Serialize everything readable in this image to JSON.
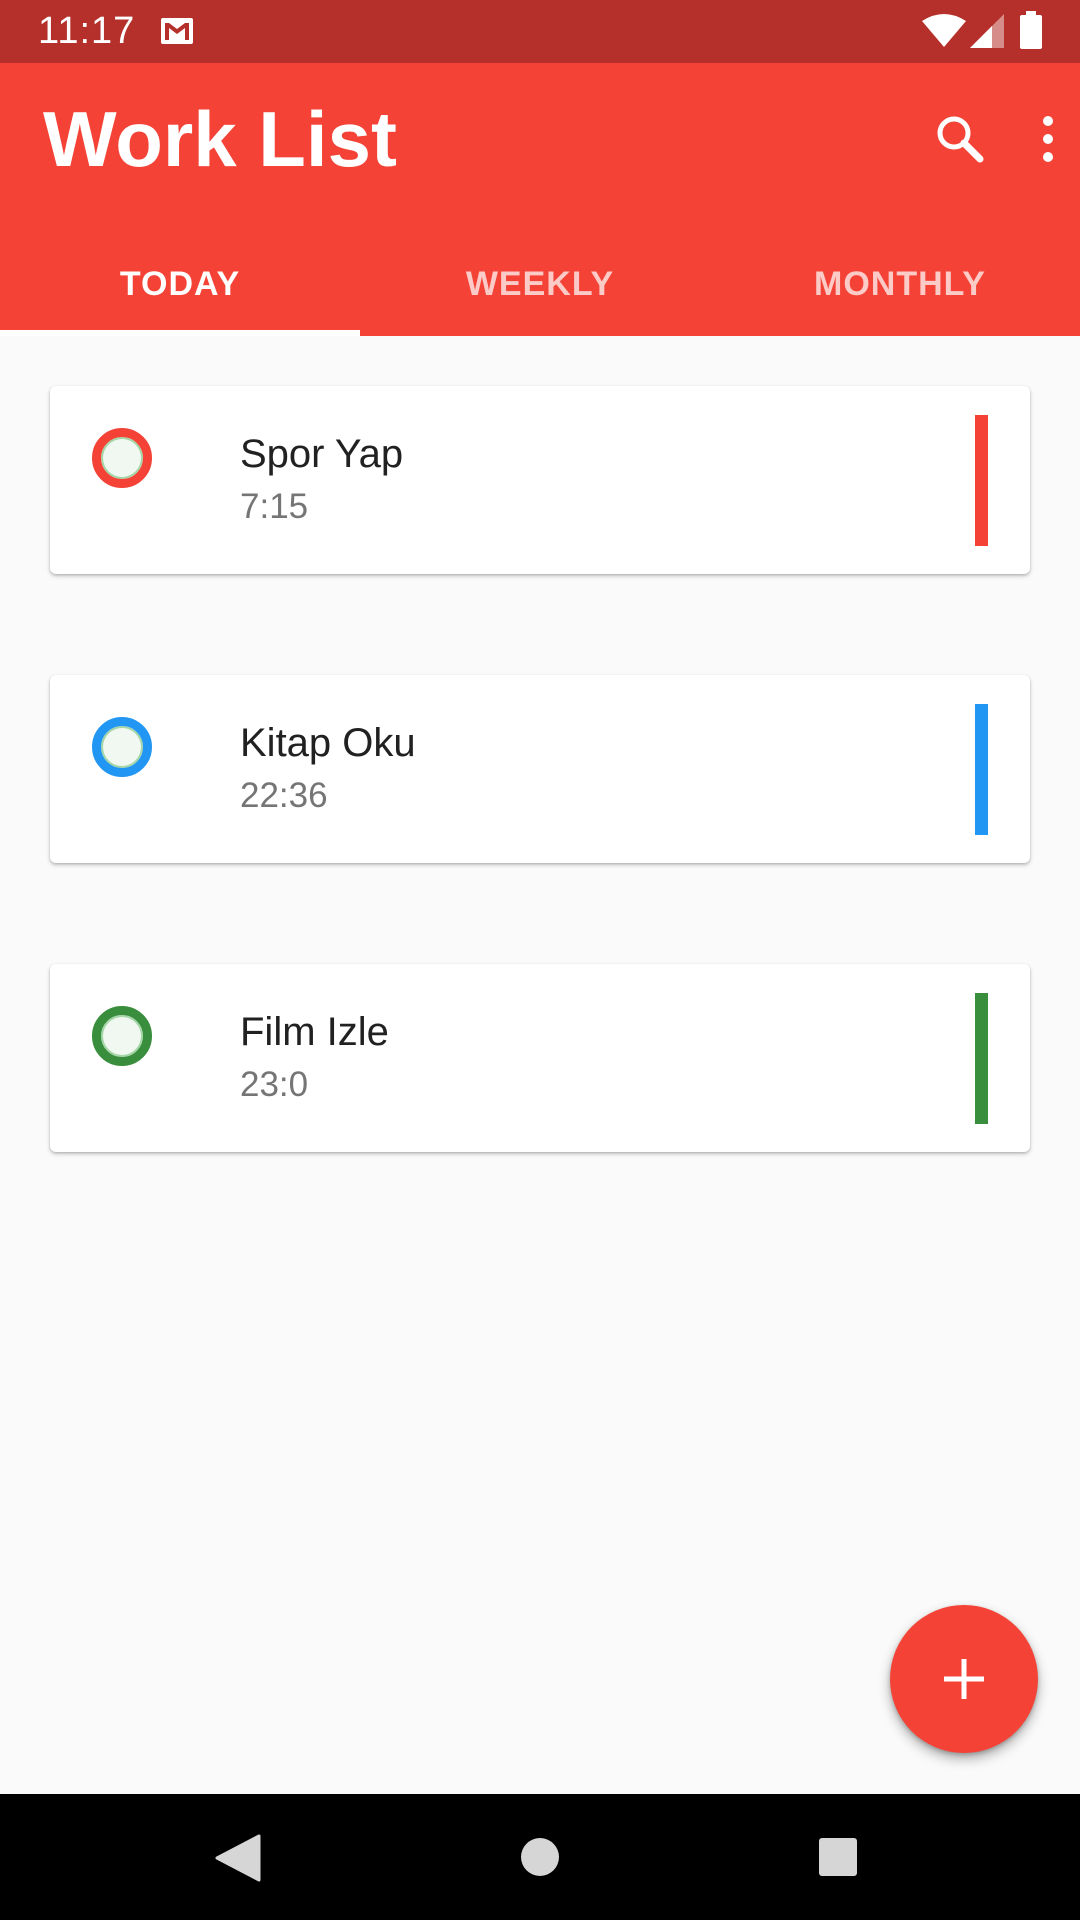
{
  "status_bar": {
    "time": "11:17",
    "icons": [
      "gmail-icon",
      "wifi-icon",
      "signal-icon",
      "battery-icon"
    ]
  },
  "app_bar": {
    "title": "Work List",
    "actions": [
      "search-icon",
      "more-vert-icon"
    ]
  },
  "tabs": [
    {
      "label": "TODAY",
      "active": true
    },
    {
      "label": "WEEKLY",
      "active": false
    },
    {
      "label": "MONTHLY",
      "active": false
    }
  ],
  "tasks": [
    {
      "title": "Spor Yap",
      "time": "7:15",
      "color": "#f44336"
    },
    {
      "title": "Kitap Oku",
      "time": "22:36",
      "color": "#2196f3"
    },
    {
      "title": "Film Izle",
      "time": "23:0",
      "color": "#388e3c"
    }
  ],
  "fab": {
    "icon": "plus-icon"
  },
  "nav_bar": {
    "icons": [
      "back-icon",
      "home-icon",
      "recents-icon"
    ]
  },
  "colors": {
    "primary": "#f44336",
    "status_bar": "#b5302b",
    "background": "#fafafa"
  }
}
